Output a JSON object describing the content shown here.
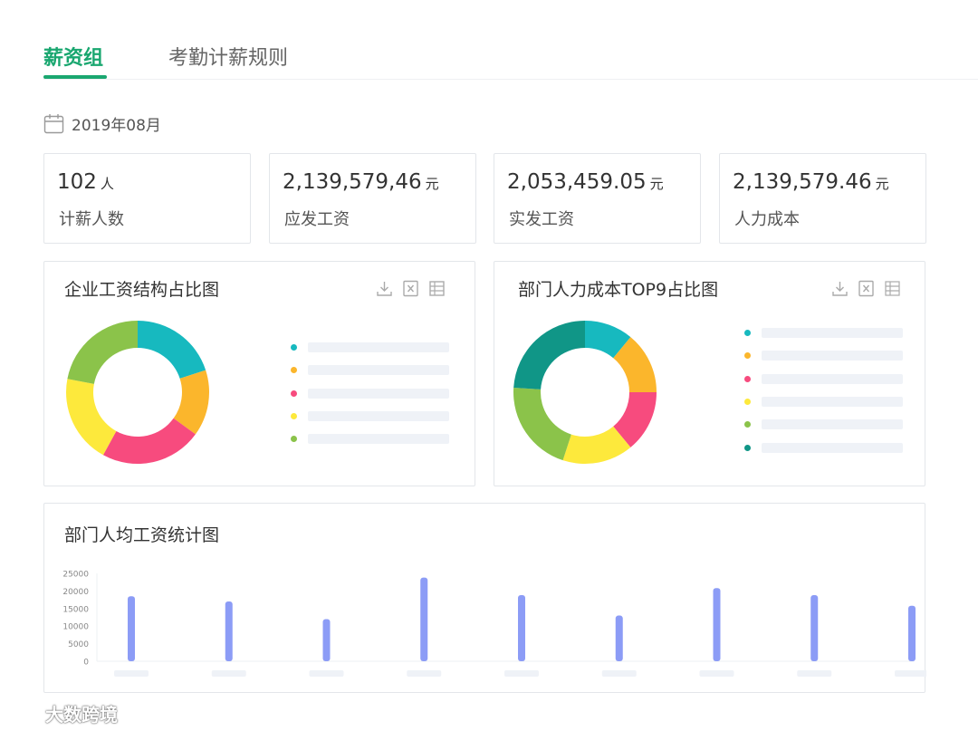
{
  "tabs": [
    {
      "label": "薪资组",
      "active": true
    },
    {
      "label": "考勤计薪规则",
      "active": false
    }
  ],
  "period": "2019年08月",
  "stats": [
    {
      "value": "102",
      "unit": "人",
      "label": "计薪人数"
    },
    {
      "value": "2,139,579,46",
      "unit": "元",
      "label": "应发工资"
    },
    {
      "value": "2,053,459.05",
      "unit": "元",
      "label": "实发工资"
    },
    {
      "value": "2,139,579.46",
      "unit": "元",
      "label": "人力成本"
    }
  ],
  "panels": {
    "salary_structure": {
      "title": "企业工资结构占比图"
    },
    "dept_cost": {
      "title": "部门人力成本TOP9占比图"
    },
    "dept_avg": {
      "title": "部门人均工资统计图"
    }
  },
  "toolbar_icons": [
    "download-icon",
    "excel-icon",
    "table-icon"
  ],
  "colors": {
    "accent": "#1aa770",
    "teal": "#17b9bf",
    "orange": "#fbb62c",
    "pink": "#f74b7e",
    "yellow": "#fde93c",
    "green": "#8bc34a",
    "darkteal": "#109687",
    "bar": "#8c9cf6"
  },
  "chart_data": [
    {
      "type": "pie",
      "donut": true,
      "slices": [
        {
          "value": 20,
          "color": "#17b9bf"
        },
        {
          "value": 15,
          "color": "#fbb62c"
        },
        {
          "value": 23,
          "color": "#f74b7e"
        },
        {
          "value": 20,
          "color": "#fde93c"
        },
        {
          "value": 22,
          "color": "#8bc34a"
        }
      ]
    },
    {
      "type": "pie",
      "donut": true,
      "slices": [
        {
          "value": 11,
          "color": "#17b9bf"
        },
        {
          "value": 14,
          "color": "#fbb62c"
        },
        {
          "value": 14,
          "color": "#f74b7e"
        },
        {
          "value": 16,
          "color": "#fde93c"
        },
        {
          "value": 21,
          "color": "#8bc34a"
        },
        {
          "value": 24,
          "color": "#109687"
        }
      ]
    },
    {
      "type": "bar",
      "categories": [
        "",
        "",
        "",
        "",
        "",
        "",
        "",
        "",
        ""
      ],
      "values": [
        18500,
        17000,
        12000,
        23800,
        18800,
        13000,
        20800,
        18800,
        15800
      ],
      "ylim": [
        0,
        25000
      ],
      "yticks": [
        0,
        5000,
        10000,
        15000,
        20000,
        25000
      ]
    }
  ],
  "watermark": "大数跨境"
}
